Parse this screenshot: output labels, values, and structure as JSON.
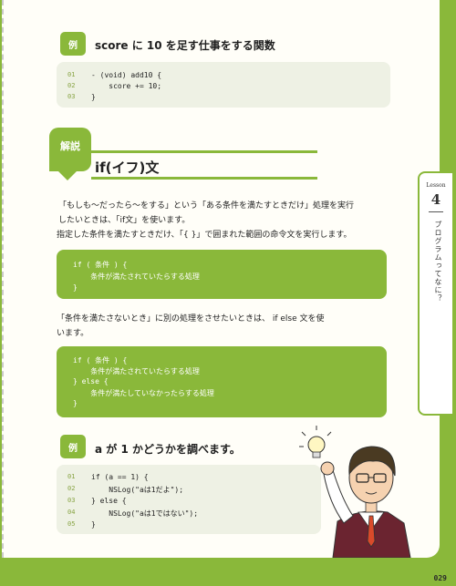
{
  "example1": {
    "badge": "例",
    "title": "score に 10 を足す仕事をする関数",
    "lines": [
      {
        "num": "01",
        "code": "- (void) add10 {"
      },
      {
        "num": "02",
        "code": "    score += 10;"
      },
      {
        "num": "03",
        "code": "}"
      }
    ]
  },
  "section": {
    "badge": "解説",
    "title": "if(イフ)文"
  },
  "paragraphs": {
    "p1": "「もしも〜だったら〜をする」という「ある条件を満たすときだけ」処理を実行",
    "p2": "したいときは、「if文」を使います。",
    "p3": "指定した条件を満たすときだけ、「{ }」で囲まれた範囲の命令文を実行します。",
    "p4": "「条件を満たさないとき」に別の処理をさせたいときは、 if else 文を使",
    "p5": "います。"
  },
  "code_if": {
    "lines": [
      "if ( 条件 ) {",
      "    条件が満たされていたらする処理",
      "}"
    ]
  },
  "code_ifelse": {
    "lines": [
      "if ( 条件 ) {",
      "    条件が満たされていたらする処理",
      "} else {",
      "    条件が満たしていなかったらする処理",
      "}"
    ]
  },
  "example2": {
    "badge": "例",
    "title": "a が 1 かどうかを調べます。",
    "lines": [
      {
        "num": "01",
        "code": "if (a == 1) {"
      },
      {
        "num": "02",
        "code": "    NSLog(\"aは1だよ\");"
      },
      {
        "num": "03",
        "code": "} else {"
      },
      {
        "num": "04",
        "code": "    NSLog(\"aは1ではない\");"
      },
      {
        "num": "05",
        "code": "}"
      }
    ]
  },
  "lesson": {
    "word": "Lesson",
    "number": "4",
    "vertical_title": "プログラムってなに？"
  },
  "page_number": "029",
  "colors": {
    "accent": "#8ab83a",
    "code_bg": "#eef1e4",
    "sheet": "#fffef8"
  }
}
